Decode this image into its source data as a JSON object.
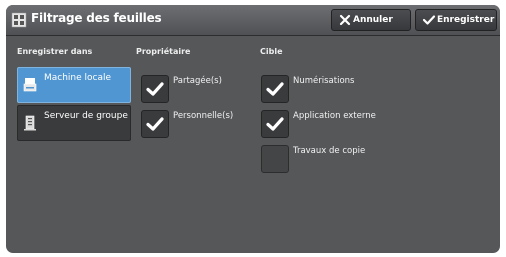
{
  "header": {
    "title": "Filtrage des feuilles",
    "cancel_label": "Annuler",
    "save_label": "Enregistrer"
  },
  "location": {
    "heading": "Enregistrer dans",
    "options": [
      {
        "label": "Machine locale",
        "selected": true
      },
      {
        "label": "Serveur de groupe",
        "selected": false
      }
    ]
  },
  "owner": {
    "heading": "Propriétaire",
    "options": [
      {
        "label": "Partagée(s)",
        "checked": true
      },
      {
        "label": "Personnelle(s)",
        "checked": true
      }
    ]
  },
  "target": {
    "heading": "Cible",
    "options": [
      {
        "label": "Numérisations",
        "checked": true
      },
      {
        "label": "Application externe",
        "checked": true
      },
      {
        "label": "Travaux de copie",
        "checked": false
      }
    ]
  },
  "colors": {
    "panel": "#555759",
    "selected": "#5096d2",
    "checkmark": "#ffffff"
  }
}
